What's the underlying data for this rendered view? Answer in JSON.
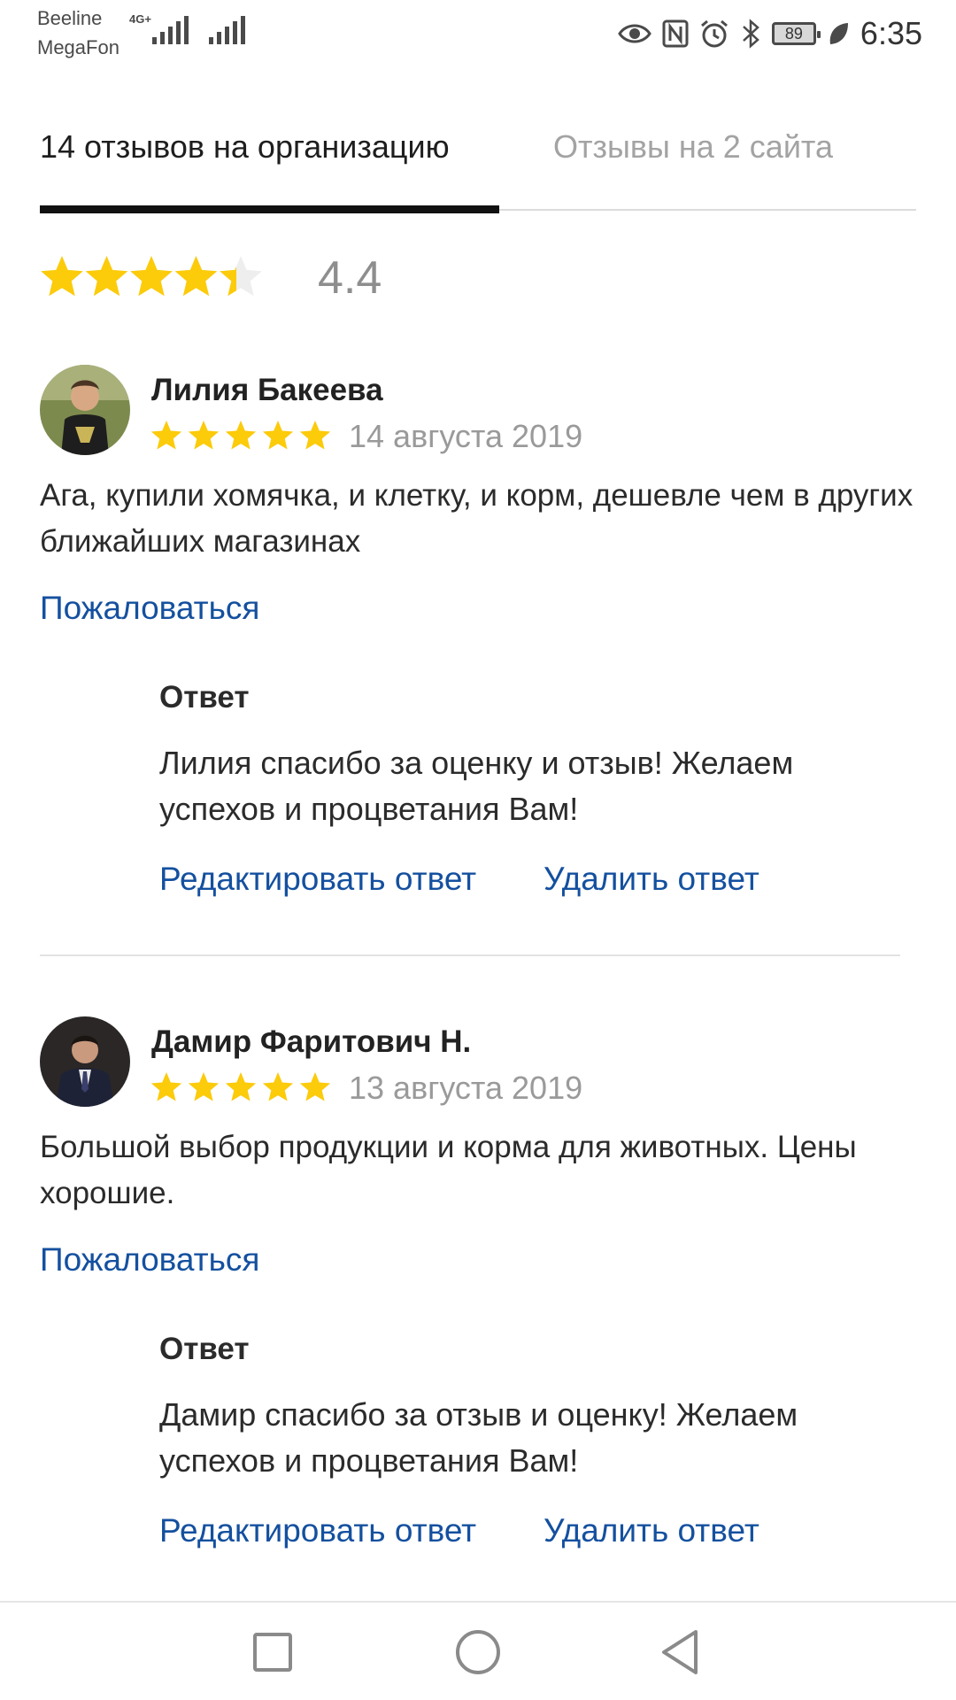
{
  "status_bar": {
    "carrier_1": "Beeline",
    "carrier_2": "MegaFon",
    "network": "4G+",
    "battery": "89",
    "time": "6:35"
  },
  "tabs": [
    {
      "label": "14 отзывов на организацию",
      "active": true
    },
    {
      "label": "Отзывы на 2 сайта",
      "active": false
    }
  ],
  "summary": {
    "rating": "4.4",
    "star_fill_fraction": 0.88
  },
  "reviews": [
    {
      "author": "Лилия Бакеева",
      "stars": 5,
      "date": "14 августа 2019",
      "text": "Ага, купили хомячка, и клетку, и корм, дешевле чем в других ближайших магазинах",
      "complain": "Пожаловаться",
      "reply": {
        "title": "Ответ",
        "text": "Лилия спасибо за оценку и отзыв! Желаем успехов и процветания Вам!",
        "edit": "Редактировать ответ",
        "delete": "Удалить ответ"
      }
    },
    {
      "author": "Дамир Фаритович Н.",
      "stars": 5,
      "date": "13 августа 2019",
      "text": "Большой выбор продукции и корма для животных. Цены хорошие.",
      "complain": "Пожаловаться",
      "reply": {
        "title": "Ответ",
        "text": "Дамир спасибо за отзыв и оценку! Желаем успехов и процветания Вам!",
        "edit": "Редактировать ответ",
        "delete": "Удалить ответ"
      }
    }
  ],
  "colors": {
    "star": "#fccb0a",
    "link": "#14509f",
    "muted": "#9a9a9a"
  },
  "icons": [
    "eye-icon",
    "nfc-icon",
    "alarm-icon",
    "bluetooth-icon",
    "battery-icon",
    "leaf-icon",
    "signal-icon",
    "star-icon",
    "avatar",
    "square-nav-icon",
    "circle-nav-icon",
    "back-triangle-icon"
  ]
}
